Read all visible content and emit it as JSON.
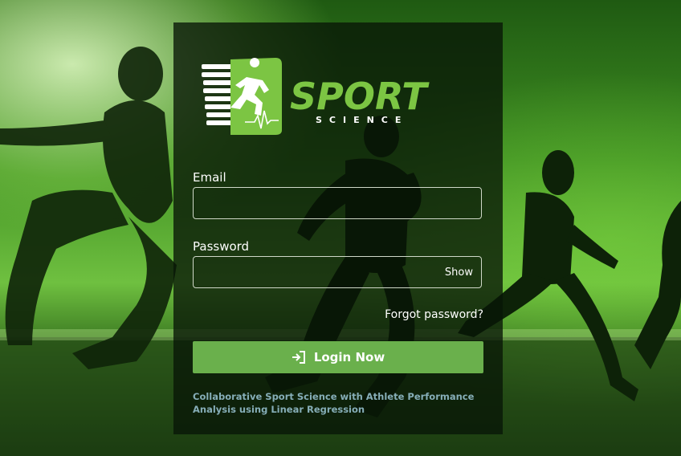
{
  "logo": {
    "word": "SPORT",
    "sub": "SCIENCE"
  },
  "form": {
    "email_label": "Email",
    "email_value": "",
    "password_label": "Password",
    "password_value": "",
    "show_label": "Show",
    "forgot_label": "Forgot password?",
    "login_label": "Login Now",
    "login_icon": "sign-in-icon"
  },
  "footer": {
    "tagline": "Collaborative Sport Science with Athlete Performance Analysis using Linear Regression"
  },
  "colors": {
    "accent": "#6ab04c",
    "logo_green": "#7cc543",
    "tagline": "#86aeb8"
  }
}
